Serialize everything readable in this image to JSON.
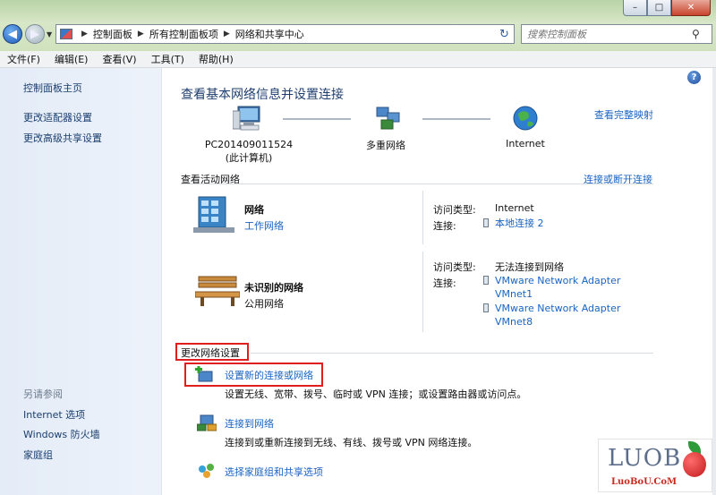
{
  "window": {
    "min": "–",
    "max": "□",
    "close": "✕"
  },
  "address": {
    "crumbs": [
      "控制面板",
      "所有控制面板项",
      "网络和共享中心"
    ],
    "separator": "▶"
  },
  "search": {
    "placeholder": "搜索控制面板"
  },
  "menu": [
    "文件(F)",
    "编辑(E)",
    "查看(V)",
    "工具(T)",
    "帮助(H)"
  ],
  "sidebar": {
    "items": [
      "控制面板主页",
      "更改适配器设置",
      "更改高级共享设置"
    ],
    "see_also_title": "另请参阅",
    "see_also": [
      "Internet 选项",
      "Windows 防火墙",
      "家庭组"
    ]
  },
  "main": {
    "title": "查看基本网络信息并设置连接",
    "full_map": "查看完整映射",
    "map": {
      "computer_line1": "PC201409011524",
      "computer_line2": "(此计算机)",
      "middle": "多重网络",
      "internet": "Internet"
    },
    "active_title": "查看活动网络",
    "connect_disconnect": "连接或断开连接",
    "networks": [
      {
        "name": "网络",
        "type": "工作网络",
        "access_label": "访问类型:",
        "access_value": "Internet",
        "conn_label": "连接:",
        "conn_values": [
          "本地连接 2"
        ]
      },
      {
        "name": "未识别的网络",
        "type": "公用网络",
        "access_label": "访问类型:",
        "access_value": "无法连接到网络",
        "conn_label": "连接:",
        "conn_values": [
          "VMware Network Adapter",
          "VMnet1",
          "VMware Network Adapter",
          "VMnet8"
        ]
      }
    ],
    "change_title": "更改网络设置",
    "tasks": [
      {
        "link": "设置新的连接或网络",
        "desc": "设置无线、宽带、拨号、临时或 VPN 连接；或设置路由器或访问点。"
      },
      {
        "link": "连接到网络",
        "desc": "连接到或重新连接到无线、有线、拨号或 VPN 网络连接。"
      },
      {
        "link": "选择家庭组和共享选项",
        "desc": ""
      }
    ],
    "help": "?"
  },
  "watermark": {
    "logo": "LUOB",
    "site": "LuoBoU.CoM"
  },
  "colors": {
    "link": "#1a64c2",
    "highlight": "#e01e1e",
    "title": "#1e3f6e"
  }
}
